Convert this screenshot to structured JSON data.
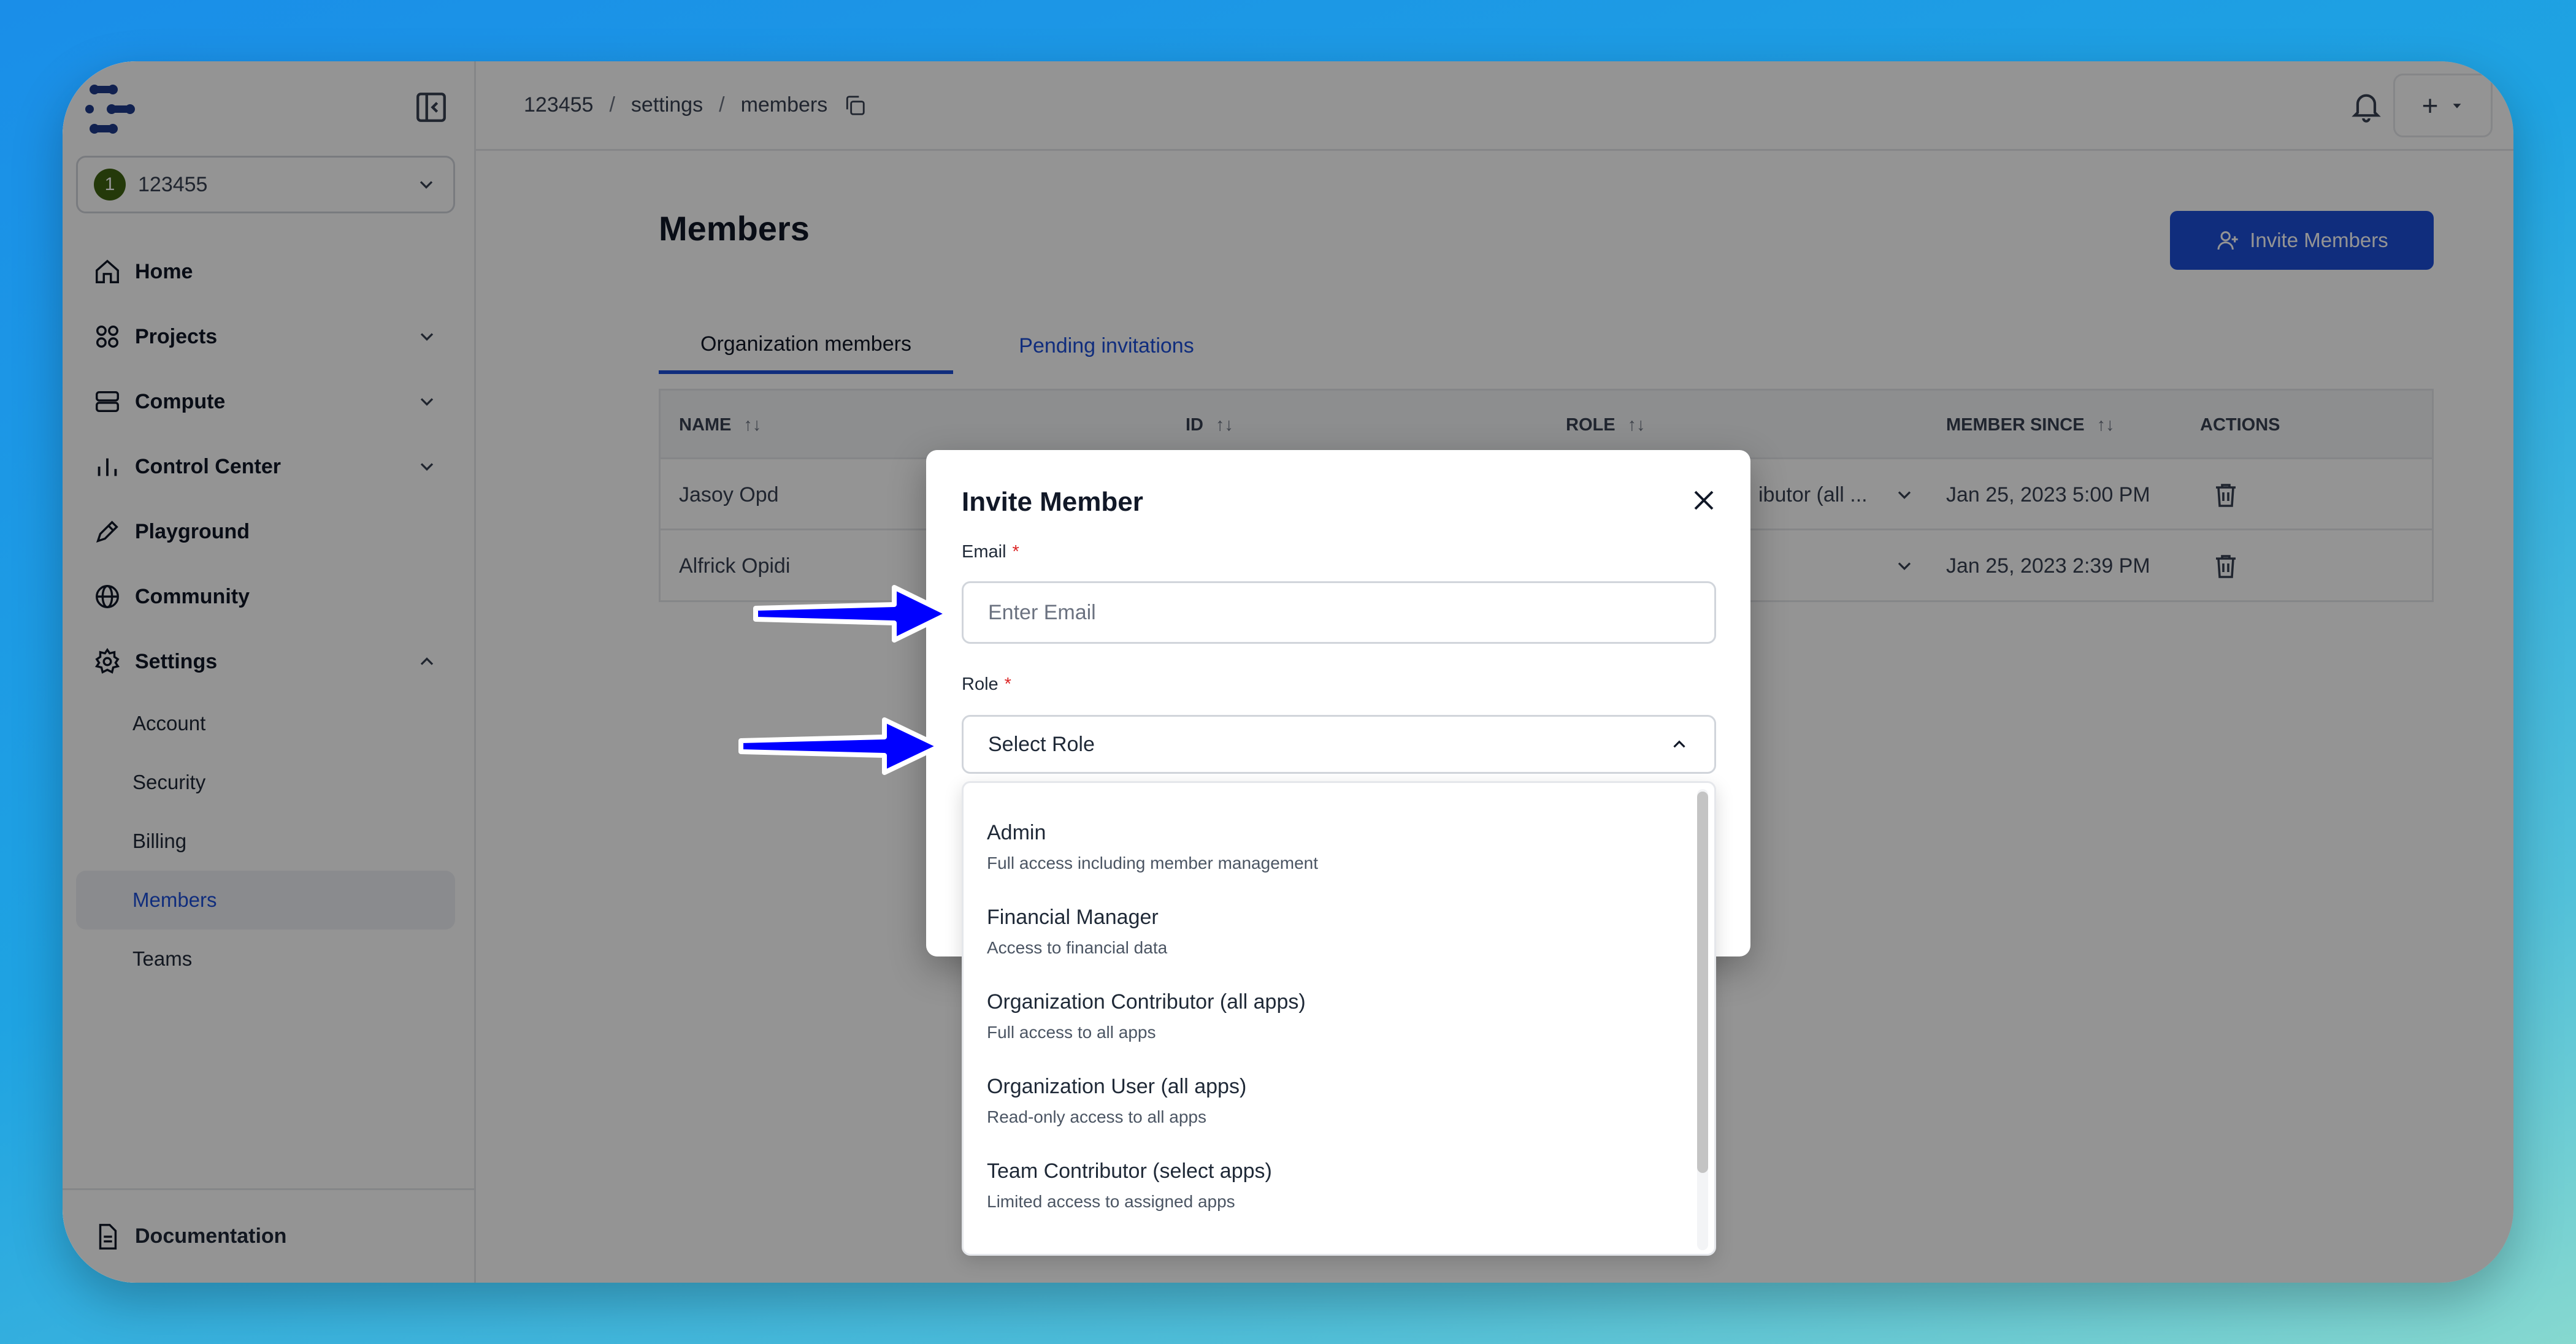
{
  "org": {
    "badge": "1",
    "name": "123455"
  },
  "sidebar": {
    "items": [
      {
        "label": "Home"
      },
      {
        "label": "Projects"
      },
      {
        "label": "Compute"
      },
      {
        "label": "Control Center"
      },
      {
        "label": "Playground"
      },
      {
        "label": "Community"
      },
      {
        "label": "Settings"
      }
    ],
    "settings_sub": [
      {
        "label": "Account"
      },
      {
        "label": "Security"
      },
      {
        "label": "Billing"
      },
      {
        "label": "Members"
      },
      {
        "label": "Teams"
      }
    ],
    "footer": "Documentation"
  },
  "breadcrumb": {
    "org": "123455",
    "sep": "/",
    "section": "settings",
    "page": "members"
  },
  "topbar": {
    "plus": "+"
  },
  "main": {
    "title": "Members",
    "invite_label": "Invite Members",
    "tabs": [
      {
        "label": "Organization members"
      },
      {
        "label": "Pending invitations"
      }
    ],
    "table": {
      "headers": [
        "NAME",
        "ID",
        "ROLE",
        "MEMBER SINCE",
        "ACTIONS"
      ],
      "sort_glyph": "↑↓",
      "rows": [
        {
          "name": "Jasoy Opd",
          "role": "ibutor (all ...",
          "since": "Jan 25, 2023 5:00 PM"
        },
        {
          "name": "Alfrick Opidi",
          "role": "",
          "since": "Jan 25, 2023 2:39 PM"
        }
      ]
    }
  },
  "modal": {
    "title": "Invite Member",
    "email_label": "Email",
    "email_placeholder": "Enter Email",
    "role_label": "Role",
    "required_mark": "*",
    "role_value": "Select Role",
    "options": [
      {
        "title": "Admin",
        "desc": "Full access including member management"
      },
      {
        "title": "Financial Manager",
        "desc": "Access to financial data"
      },
      {
        "title": "Organization Contributor (all apps)",
        "desc": "Full access to all apps"
      },
      {
        "title": "Organization User (all apps)",
        "desc": "Read-only access to all apps"
      },
      {
        "title": "Team Contributor (select apps)",
        "desc": "Limited access to assigned apps"
      }
    ]
  },
  "colors": {
    "accent": "#1d4ed8",
    "arrow": "#0000ff",
    "org_badge": "#3f6212"
  }
}
